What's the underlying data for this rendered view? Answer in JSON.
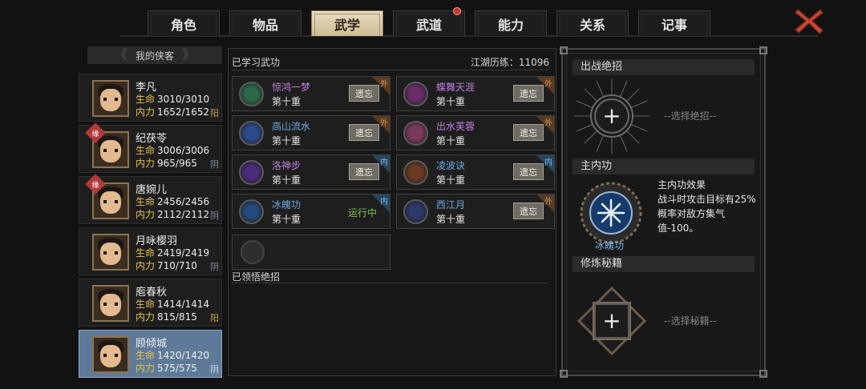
{
  "tabs": [
    {
      "label": "角色"
    },
    {
      "label": "物品"
    },
    {
      "label": "武学",
      "active": true
    },
    {
      "label": "武道",
      "badge": true
    },
    {
      "label": "能力"
    },
    {
      "label": "关系"
    },
    {
      "label": "记事"
    }
  ],
  "list_header": "我的侠客",
  "characters": [
    {
      "name": "李凡",
      "hp_label": "生命",
      "hp": "3010/3010",
      "mp_label": "内力",
      "mp": "1652/1652",
      "nature": "阳"
    },
    {
      "name": "纪茯苓",
      "tag": "缘",
      "hp_label": "生命",
      "hp": "3006/3006",
      "mp_label": "内力",
      "mp": "965/965",
      "nature": "阴"
    },
    {
      "name": "唐婉儿",
      "tag": "缘",
      "hp_label": "生命",
      "hp": "2456/2456",
      "mp_label": "内力",
      "mp": "2112/2112",
      "nature": "阴"
    },
    {
      "name": "月咏樱羽",
      "hp_label": "生命",
      "hp": "2419/2419",
      "mp_label": "内力",
      "mp": "710/710",
      "nature": "阴"
    },
    {
      "name": "庖春秋",
      "hp_label": "生命",
      "hp": "1414/1414",
      "mp_label": "内力",
      "mp": "815/815",
      "nature": "阳"
    },
    {
      "name": "顾倾城",
      "hp_label": "生命",
      "hp": "1420/1420",
      "mp_label": "内力",
      "mp": "575/575",
      "nature": "阴",
      "active": true
    }
  ],
  "learned": {
    "title": "已学习武功",
    "exp_label": "江湖历练：11096"
  },
  "skills": [
    {
      "name": "惊鸿一梦",
      "level": "第十重",
      "action": "遗忘",
      "type": "外",
      "color": "#c27fe0",
      "icon_bg": "#2d6a4a"
    },
    {
      "name": "蝶舞天涯",
      "level": "第十重",
      "action": "遗忘",
      "type": "外",
      "color": "#c27fe0",
      "icon_bg": "#6a2d6a"
    },
    {
      "name": "高山流水",
      "level": "第十重",
      "action": "遗忘",
      "type": "外",
      "color": "#6fa8dc",
      "icon_bg": "#2d4a8a"
    },
    {
      "name": "出水芙蓉",
      "level": "第十重",
      "action": "遗忘",
      "type": "外",
      "color": "#c27fe0",
      "icon_bg": "#7a3a5a"
    },
    {
      "name": "洛神步",
      "level": "第十重",
      "action": "遗忘",
      "type": "内",
      "color": "#c27fe0",
      "icon_bg": "#4a2d7a"
    },
    {
      "name": "凌波诀",
      "level": "第十重",
      "action": "遗忘",
      "type": "内",
      "color": "#6fa8dc",
      "icon_bg": "#6a3a22"
    },
    {
      "name": "冰魄功",
      "level": "第十重",
      "action": "运行中",
      "type": "内",
      "color": "#6fa8dc",
      "icon_bg": "#234a7a"
    },
    {
      "name": "西江月",
      "level": "第十重",
      "action": "遗忘",
      "type": "外",
      "color": "#6fa8dc",
      "icon_bg": "#2d3a6a"
    }
  ],
  "comprehended_title": "已领悟绝招",
  "right": {
    "battle_title": "出战绝招",
    "battle_placeholder": "--选择绝招--",
    "main_title": "主内功",
    "main_skill_name": "冰魄功",
    "effect_title": "主内功效果",
    "effect_text": "战斗时攻击目标有25%概率对敌方集气值-100。",
    "manual_title": "修炼秘籍",
    "manual_placeholder": "--选择秘籍--",
    "plus_symbol": "+"
  },
  "colors": {
    "gold": "#e8c24a",
    "outer_tag": "#c89a5a",
    "inner_tag": "#7fb8e8",
    "running": "#78c24f"
  },
  "icons": [
    "close-icon",
    "plus-icon",
    "skill-icon"
  ]
}
